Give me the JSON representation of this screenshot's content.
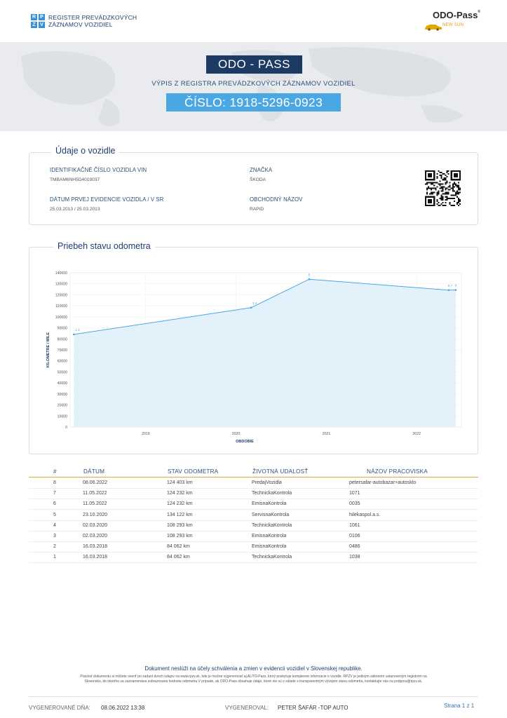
{
  "header": {
    "rpzv_letters": [
      "R",
      "P",
      "Z",
      "V"
    ],
    "rpzv_line1": "REGISTER PREVÁDZKOVÝCH",
    "rpzv_line2": "ZÁZNAMOV VOZIDIEL",
    "odo_logo_name": "ODO-Pass",
    "odo_logo_reg": "®",
    "odo_logo_tag": "NEW SUN",
    "logo_accent": "#d9a20a"
  },
  "banner": {
    "title": "ODO - PASS",
    "subtitle": "VÝPIS Z REGISTRA PREVÁDZKOVÝCH ZÁZNAMOV VOZIDIEL",
    "number": "ČÍSLO: 1918-5296-0923",
    "title_color": "#1d3a62",
    "number_color": "#4aa7e2"
  },
  "vehicle": {
    "section_title": "Údaje o vozidle",
    "vin_label": "IDENTIFIKAČNÉ ČÍSLO VOZIDLA VIN",
    "vin_value": "TMBAM6NH5D4019037",
    "brand_label": "ZNAČKA",
    "brand_value": "ŠKODA",
    "first_reg_label": "DÁTUM PRVEJ EVIDENCIE VOZIDLA / V SR",
    "first_reg_value": "25.03.2013 / 25.03.2013",
    "trade_name_label": "OBCHODNÝ NÁZOV",
    "trade_name_value": "RAPID"
  },
  "odometer": {
    "section_title": "Priebeh stavu odometra"
  },
  "chart_data": {
    "type": "area",
    "title": "",
    "xlabel": "OBDOBIE",
    "ylabel": "KILOMETRE / MILE",
    "ylim": [
      0,
      140000
    ],
    "yticks": [
      0,
      10000,
      20000,
      30000,
      40000,
      50000,
      60000,
      70000,
      80000,
      90000,
      100000,
      110000,
      120000,
      130000,
      140000
    ],
    "xticks": [
      "2019",
      "2020",
      "2021",
      "2022"
    ],
    "xlim": [
      "2018-03-01",
      "2022-07-01"
    ],
    "grid": true,
    "legend": "none",
    "line_color": "#4aa7e2",
    "fill_color": "#e3f1fb",
    "points": [
      {
        "date": "2018-03-16",
        "value": 84062,
        "label": "1 2"
      },
      {
        "date": "2020-03-02",
        "value": 108293,
        "label": "3 4"
      },
      {
        "date": "2020-10-23",
        "value": 134122,
        "label": "5"
      },
      {
        "date": "2022-05-11",
        "value": 124232,
        "label": "6 7"
      },
      {
        "date": "2022-06-08",
        "value": 124403,
        "label": "8"
      }
    ]
  },
  "table": {
    "headers": [
      "#",
      "DÁTUM",
      "STAV ODOMETRA",
      "ŽIVOTNÁ UDALOSŤ",
      "NÁZOV PRACOVISKA"
    ],
    "rows": [
      [
        "8",
        "08.06.2022",
        "124 403 km",
        "PredajVozidla",
        "petersafar-autobazar+autosklo"
      ],
      [
        "7",
        "11.05.2022",
        "124 232 km",
        "TechnickaKontrola",
        "1071"
      ],
      [
        "6",
        "11.05.2022",
        "124 232 km",
        "EmisnaKontrola",
        "0035"
      ],
      [
        "5",
        "23.10.2020",
        "134 122 km",
        "ServisnaKontrola",
        "hilekaspol.a.s."
      ],
      [
        "4",
        "02.03.2020",
        "108 293 km",
        "TechnickaKontrola",
        "1061"
      ],
      [
        "3",
        "02.03.2020",
        "108 293 km",
        "EmisnaKontrola",
        "0106"
      ],
      [
        "2",
        "16.03.2018",
        "84 062 km",
        "EmisnaKontrola",
        "0486"
      ],
      [
        "1",
        "16.03.2018",
        "84 062 km",
        "TechnickaKontrola",
        "1038"
      ]
    ]
  },
  "footer": {
    "notice": "Dokument neslúži na účely schválenia a zmien v evidencii vozidiel v Slovenskej republike.",
    "small_line1": "Pravosť dokumentu si môžete overiť po zadaní dvoch údajov na www.rpzv.sk, kde je možné vygenerovať aj AUTO-Pass, ktorý poskytuje komplexné informácie o vozidle. RPZV je jediným zákonom ustanoveným registrom na",
    "small_line2": "Slovensku, do ktorého sa zaznamenáva zobrazovaná hodnota odometra.V prípade, ak ODO-Pass obsahuje údaje, ktoré nie sú v súlade s transparentným vývojom stavu odometra, kontaktujte nás na podpora@rpzv.sk.",
    "generated_date_label": "VYGENEROVANÉ DŇA:",
    "generated_date_value": "08.06.2022  13:38",
    "generated_by_label": "VYGENEROVAL:",
    "generated_by_value": "PETER ŠAFÁR -TOP AUTO",
    "page": "Strana 1 z 1"
  }
}
